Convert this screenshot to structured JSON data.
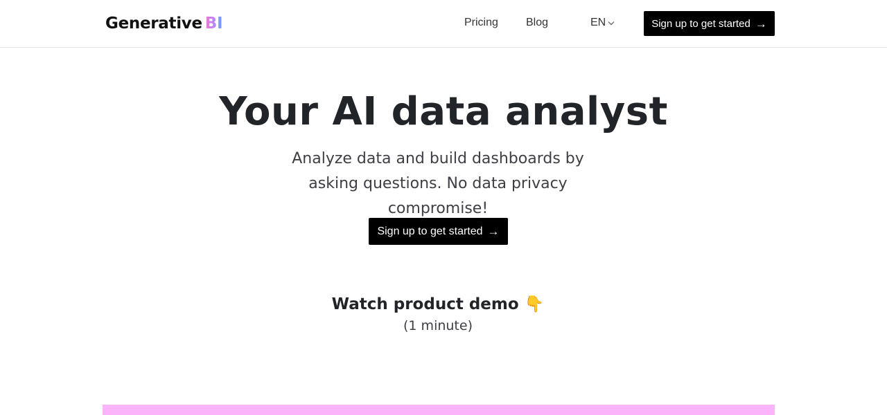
{
  "navbar": {
    "logo_text": "Generative",
    "logo_accent": "BI",
    "links": [
      {
        "label": "Pricing"
      },
      {
        "label": "Blog"
      }
    ],
    "language": {
      "selected": "EN",
      "icon": "chevron-down-icon"
    },
    "cta_label": "Sign up to get started",
    "cta_icon": "→"
  },
  "hero": {
    "title": "Your AI data analyst",
    "subtitle": "Analyze data and build dashboards by asking questions. No data privacy compromise!",
    "cta_label": "Sign up to get started",
    "cta_icon": "→"
  },
  "demo": {
    "title": "Watch product demo 👇",
    "duration": "(1 minute)"
  },
  "colors": {
    "button_bg": "#000000",
    "video_placeholder": "#fbb4fa",
    "logo_gradient": [
      "#f472d0",
      "#c084fc",
      "#60a5fa"
    ]
  }
}
